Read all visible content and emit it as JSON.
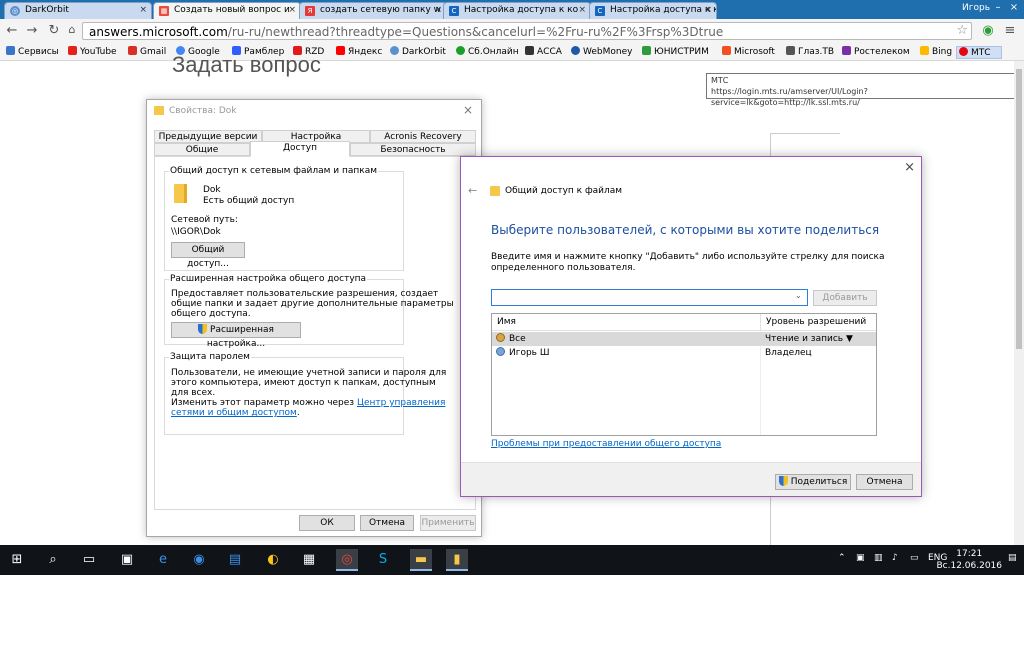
{
  "browser": {
    "tabs": [
      {
        "label": "DarkOrbit",
        "icon": "globe-icon",
        "color": "#5a8fd0"
      },
      {
        "label": "Создать новый вопрос и",
        "icon": "windows-icon",
        "color": "#e74c3c"
      },
      {
        "label": "создать сетевую папку w",
        "icon": "yandex-icon",
        "color": "#e53935"
      },
      {
        "label": "Настройка доступа к ко",
        "icon": "cf-icon",
        "color": "#1565c0"
      },
      {
        "label": "Настройка доступа к ко",
        "icon": "cf-icon",
        "color": "#1565c0"
      }
    ],
    "user": "Игорь",
    "url_host": "answers.microsoft.com",
    "url_path": "/ru-ru/newthread?threadtype=Questions&cancelurl=%2Fru-ru%2F%3Frsp%3Dtrue",
    "bookmarks": [
      {
        "label": "Сервисы",
        "color": "#3b75c9"
      },
      {
        "label": "YouTube",
        "color": "#e62117"
      },
      {
        "label": "Gmail",
        "color": "#d93025"
      },
      {
        "label": "Google",
        "color": "#4285f4"
      },
      {
        "label": "Рамблер",
        "color": "#315efb"
      },
      {
        "label": "RZD",
        "color": "#e21a1a"
      },
      {
        "label": "Яндекс",
        "color": "#ff0000"
      },
      {
        "label": "DarkOrbit",
        "color": "#5a8fd0"
      },
      {
        "label": "Сб.Онлайн",
        "color": "#1a9f29"
      },
      {
        "label": "АССА",
        "color": "#333333"
      },
      {
        "label": "WebMoney",
        "color": "#1e5aa8"
      },
      {
        "label": "ЮНИСТРИМ",
        "color": "#2c9c3c"
      },
      {
        "label": "Microsoft",
        "color": "#f25022"
      },
      {
        "label": "Глаз.ТВ",
        "color": "#555555"
      },
      {
        "label": "Ростелеком",
        "color": "#7b2fa6"
      },
      {
        "label": "Bing",
        "color": "#ffb900"
      },
      {
        "label": "МТС",
        "color": "#e30611"
      }
    ]
  },
  "page": {
    "heading": "Задать вопрос",
    "tooltip_title": "МТС",
    "tooltip_url": "https://login.mts.ru/amserver/UI/Login?service=lk&goto=http://lk.ssl.mts.ru/"
  },
  "props": {
    "title": "Свойства: Dok",
    "tabs_row1": [
      "Предыдущие версии",
      "Настройка",
      "Acronis Recovery"
    ],
    "tabs_row2": [
      "Общие",
      "Доступ",
      "Безопасность"
    ],
    "share_group_title": "Общий доступ к сетевым файлам и папкам",
    "folder_name": "Dok",
    "folder_status": "Есть общий доступ",
    "net_path_label": "Сетевой путь:",
    "net_path": "\\\\IGOR\\Dok",
    "share_button": "Общий доступ...",
    "adv_group_title": "Расширенная настройка общего доступа",
    "adv_text": [
      "Предоставляет пользовательские разрешения, создает",
      "общие папки и задает другие дополнительные параметры",
      "общего доступа."
    ],
    "adv_button": "Расширенная настройка...",
    "pwd_group_title": "Защита паролем",
    "pwd_text": [
      "Пользователи, не имеющие учетной записи и пароля для",
      "этого компьютера, имеют доступ к папкам, доступным",
      "для всех.",
      "Изменить этот параметр можно через "
    ],
    "pwd_link1": "Центр управления",
    "pwd_link2": "сетями и общим доступом",
    "pwd_end": ".",
    "ok": "ОК",
    "cancel": "Отмена",
    "apply": "Применить"
  },
  "share": {
    "title": "Общий доступ к файлам",
    "heading": "Выберите пользователей, с которыми вы хотите поделиться",
    "instructions": "Введите имя и нажмите кнопку \"Добавить\" либо используйте стрелку для поиска определенного пользователя.",
    "name_value": "",
    "add_button": "Добавить",
    "col_name": "Имя",
    "col_perm": "Уровень разрешений",
    "rows": [
      {
        "name": "Все",
        "perm": "Чтение и запись"
      },
      {
        "name": "Игорь Ш",
        "perm": "Владелец"
      }
    ],
    "problems_link": "Проблемы при предоставлении общего доступа",
    "share_button": "Поделиться",
    "cancel_button": "Отмена"
  },
  "taskbar": {
    "lang": "ENG",
    "time": "17:21",
    "date": "Вс.12.06.2016"
  }
}
